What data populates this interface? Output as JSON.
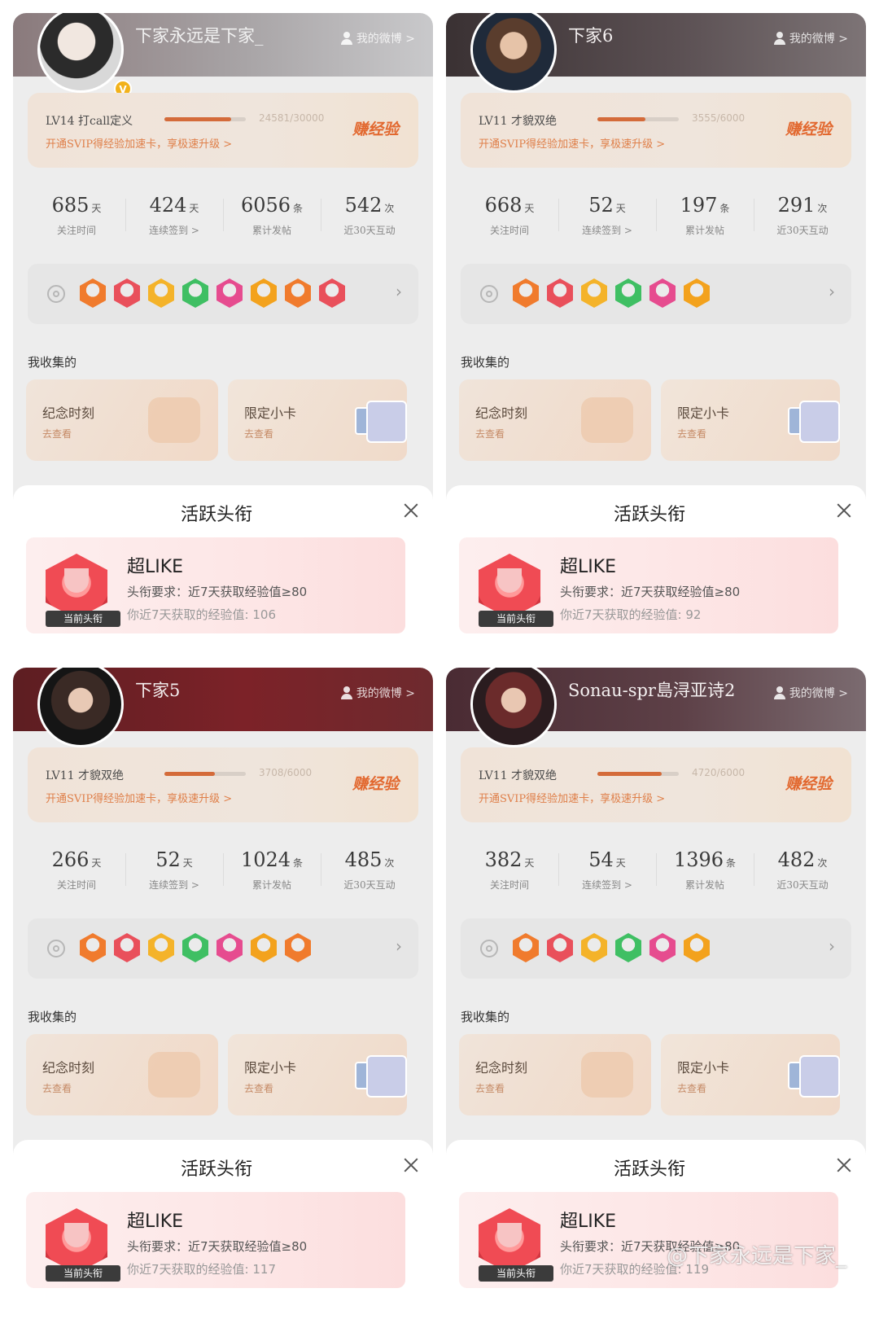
{
  "colors": {
    "accent_orange": "#e2682f",
    "badge_red": "#f04b54",
    "medal_palette": [
      "#f07b2d",
      "#e9505b",
      "#f4b32a",
      "#3fbf63",
      "#e64c8f",
      "#f3a21d"
    ]
  },
  "common": {
    "weibo_link": "我的微博 >",
    "svip_text": "开通SVIP得经验加速卡，享极速升级 >",
    "earn_label": "赚经验",
    "stat_labels": [
      "关注时间",
      "连续签到 >",
      "累计发帖",
      "近30天互动"
    ],
    "stat_units": [
      "天",
      "天",
      "条",
      "次"
    ],
    "collect_title": "我收集的",
    "collect_cards": [
      {
        "title": "纪念时刻",
        "sub": "去查看"
      },
      {
        "title": "限定小卡",
        "sub": "去查看"
      }
    ],
    "sheet_title": "活跃头衔",
    "badge_name": "超LIKE",
    "badge_req": "头衔要求：近7天获取经验值≥80",
    "current_tag": "当前头衔",
    "exp_prefix": "你近7天获取的经验值: "
  },
  "panels": [
    {
      "nickname": "下家永远是下家_",
      "level": "LV14 打call定义",
      "exp": "24581/30000",
      "progress": 0.82,
      "stats": [
        "685",
        "424",
        "6056",
        "542"
      ],
      "medal_count": 8,
      "weekly_exp": "你近7天获取的经验值: 106"
    },
    {
      "nickname": "下家6",
      "level": "LV11 才貌双绝",
      "exp": "3555/6000",
      "progress": 0.59,
      "stats": [
        "668",
        "52",
        "197",
        "291"
      ],
      "medal_count": 6,
      "weekly_exp": "你近7天获取的经验值: 92"
    },
    {
      "nickname": "下家5",
      "level": "LV11 才貌双绝",
      "exp": "3708/6000",
      "progress": 0.62,
      "stats": [
        "266",
        "52",
        "1024",
        "485"
      ],
      "medal_count": 7,
      "weekly_exp": "你近7天获取的经验值: 117"
    },
    {
      "nickname": "Sonau-spr島浔亚诗2",
      "level": "LV11 才貌双绝",
      "exp": "4720/6000",
      "progress": 0.79,
      "stats": [
        "382",
        "54",
        "1396",
        "482"
      ],
      "medal_count": 6,
      "weekly_exp": "你近7天获取的经验值: 119"
    }
  ],
  "watermark": "@下家永远是下家_"
}
